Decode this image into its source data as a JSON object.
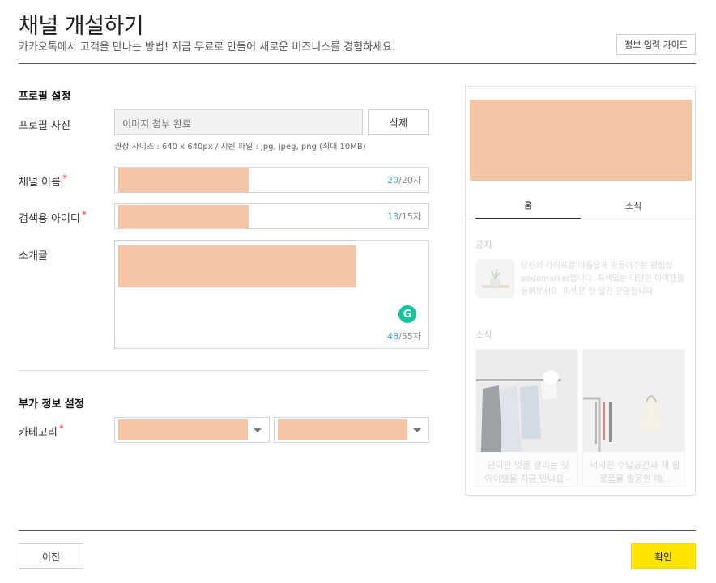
{
  "header": {
    "title": "채널 개설하기",
    "subtitle": "카카오톡에서 고객을 만나는 방법! 지금 무료로 만들어 새로운 비즈니스를 경험하세요.",
    "guide_button": "정보 입력 가이드"
  },
  "profile_section": {
    "title": "프로필 설정",
    "photo": {
      "label": "프로필 사진",
      "value": "이미지 첨부 완료",
      "delete_button": "삭제",
      "hint": "권장 사이즈 : 640 x 640px / 지원 파일 : jpg, jpeg, png (최대 10MB)"
    },
    "channel_name": {
      "label": "채널 이름",
      "required_mark": "*",
      "count": "20",
      "max": "/20자"
    },
    "search_id": {
      "label": "검색용 아이디",
      "required_mark": "*",
      "count": "13",
      "max": "/15자"
    },
    "intro": {
      "label": "소개글",
      "count": "48",
      "max": "/55자",
      "grammarly_icon": "G"
    }
  },
  "extra_section": {
    "title": "부가 정보 설정",
    "category": {
      "label": "카테고리",
      "required_mark": "*"
    }
  },
  "preview": {
    "tabs": [
      "홈",
      "소식"
    ],
    "notice_heading": "공지",
    "notice_text": "당신의 라이프를 아름답게 만들어주는 편집샵 podomarket입니다. 특색있는 다양한 아이템을 들여보세요. 마켓은 한 달간 운영됩니다.",
    "news_heading": "소식",
    "cards": [
      {
        "text": "댄디한 멋을 살리는 잇 아이템을 지금 만나요~"
      },
      {
        "text": "넉넉한 수납공간과 재 활용품을 활용한 예..."
      }
    ]
  },
  "footer": {
    "prev_button": "이전",
    "confirm_button": "확인"
  },
  "colors": {
    "accent_yellow": "#fee500",
    "counter_blue": "#4aa3c9",
    "required_red": "#ff3b30",
    "redaction": "#f5c6a5"
  }
}
